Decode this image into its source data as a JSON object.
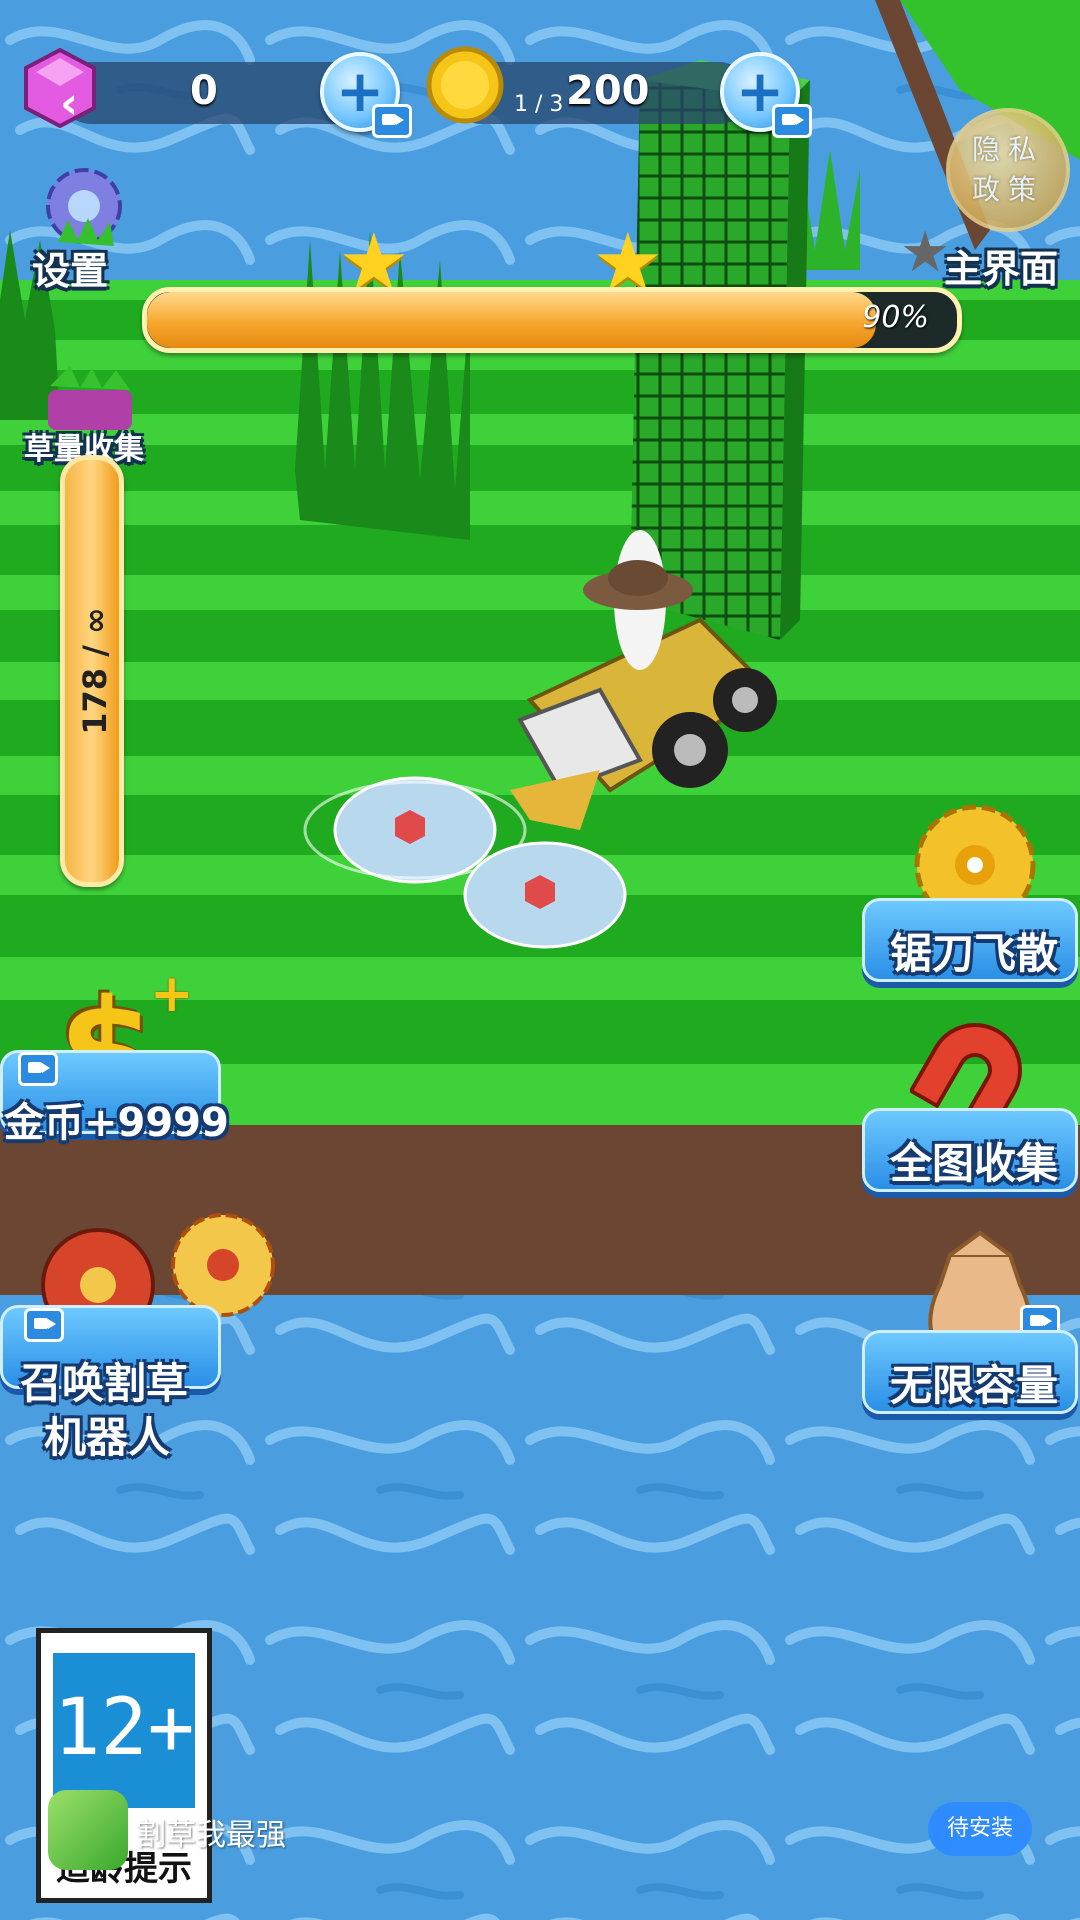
{
  "hud": {
    "gems": "0",
    "coins": "200",
    "level_progress": "1 / 3"
  },
  "privacy": {
    "label": "隐私政策"
  },
  "settings": {
    "label": "设置"
  },
  "main_menu": {
    "label": "主界面"
  },
  "progress": {
    "percent_text": "90%",
    "fraction": 0.9
  },
  "grass_collect": {
    "label": "草量收集",
    "capacity_text": "178 / ∞"
  },
  "powerups": {
    "coins_bonus": "金币+9999",
    "summon_robot_line1": "召唤割草",
    "summon_robot_line2": "机器人",
    "saw_scatter": "锯刀飞散",
    "collect_all": "全图收集",
    "unlimited_capacity": "无限容量"
  },
  "banner": {
    "age_rating": "12+",
    "age_label": "适龄提示",
    "app_name": "割草我最强",
    "install_label": "待安装"
  },
  "colors": {
    "water": "#4a9ee0",
    "grass_light": "#3fd13a",
    "grass_dark": "#1faa20",
    "dirt": "#6b4733",
    "accent_blue": "#2a8fe6"
  }
}
